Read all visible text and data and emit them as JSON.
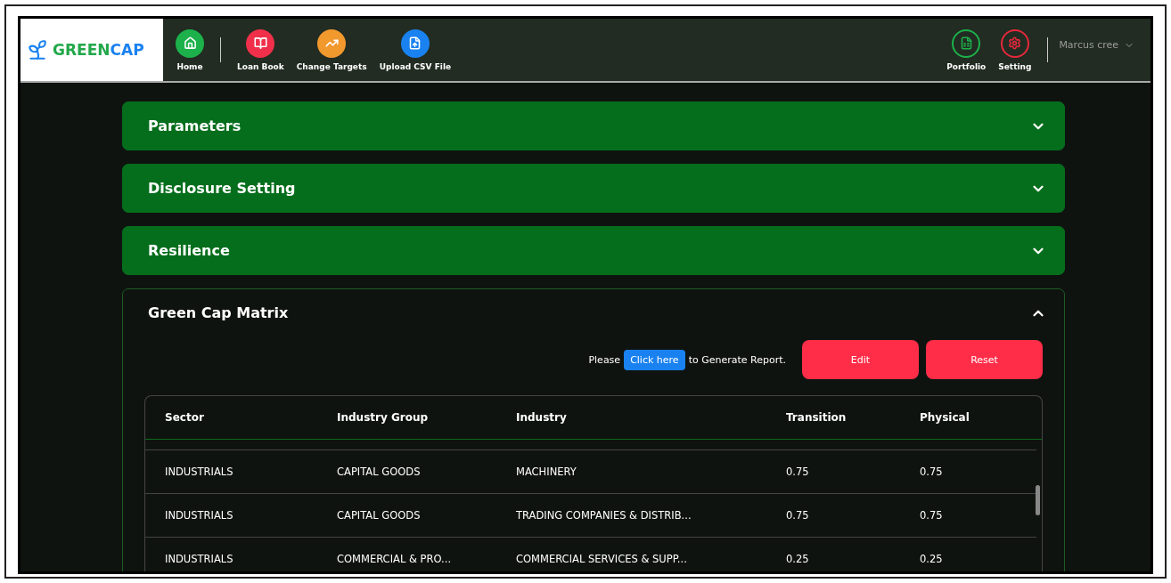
{
  "brand": {
    "part1": "GREEN",
    "part2": "CAP"
  },
  "nav": [
    {
      "label": "Home",
      "color": "#1db14b",
      "kind": "home"
    },
    {
      "label": "Loan Book",
      "color": "#f0304a",
      "kind": "book"
    },
    {
      "label": "Change Targets",
      "color": "#f2992e",
      "kind": "chart"
    },
    {
      "label": "Upload CSV File",
      "color": "#1a82f0",
      "kind": "upload"
    }
  ],
  "right_nav": [
    {
      "label": "Portfolio",
      "color": "#1db14b",
      "kind": "file"
    },
    {
      "label": "Setting",
      "color": "#e8283c",
      "kind": "gear"
    }
  ],
  "user": {
    "name": "Marcus cree"
  },
  "sections": [
    {
      "title": "Parameters",
      "expanded": false
    },
    {
      "title": "Disclosure Setting",
      "expanded": false
    },
    {
      "title": "Resilience",
      "expanded": false
    },
    {
      "title": "Green Cap Matrix",
      "expanded": true
    }
  ],
  "report": {
    "before": "Please",
    "link": "Click here",
    "after": "to Generate Report."
  },
  "buttons": [
    "Edit",
    "Reset"
  ],
  "table": {
    "columns": [
      "Sector",
      "Industry Group",
      "Industry",
      "Transition",
      "Physical"
    ],
    "rows": [
      [
        "INDUSTRIALS",
        "CAPITAL GOODS",
        "MACHINERY",
        "0.75",
        "0.75"
      ],
      [
        "INDUSTRIALS",
        "CAPITAL GOODS",
        "TRADING COMPANIES & DISTRIB...",
        "0.75",
        "0.75"
      ],
      [
        "INDUSTRIALS",
        "COMMERCIAL & PRO...",
        "COMMERCIAL SERVICES & SUPP...",
        "0.25",
        "0.25"
      ]
    ]
  }
}
